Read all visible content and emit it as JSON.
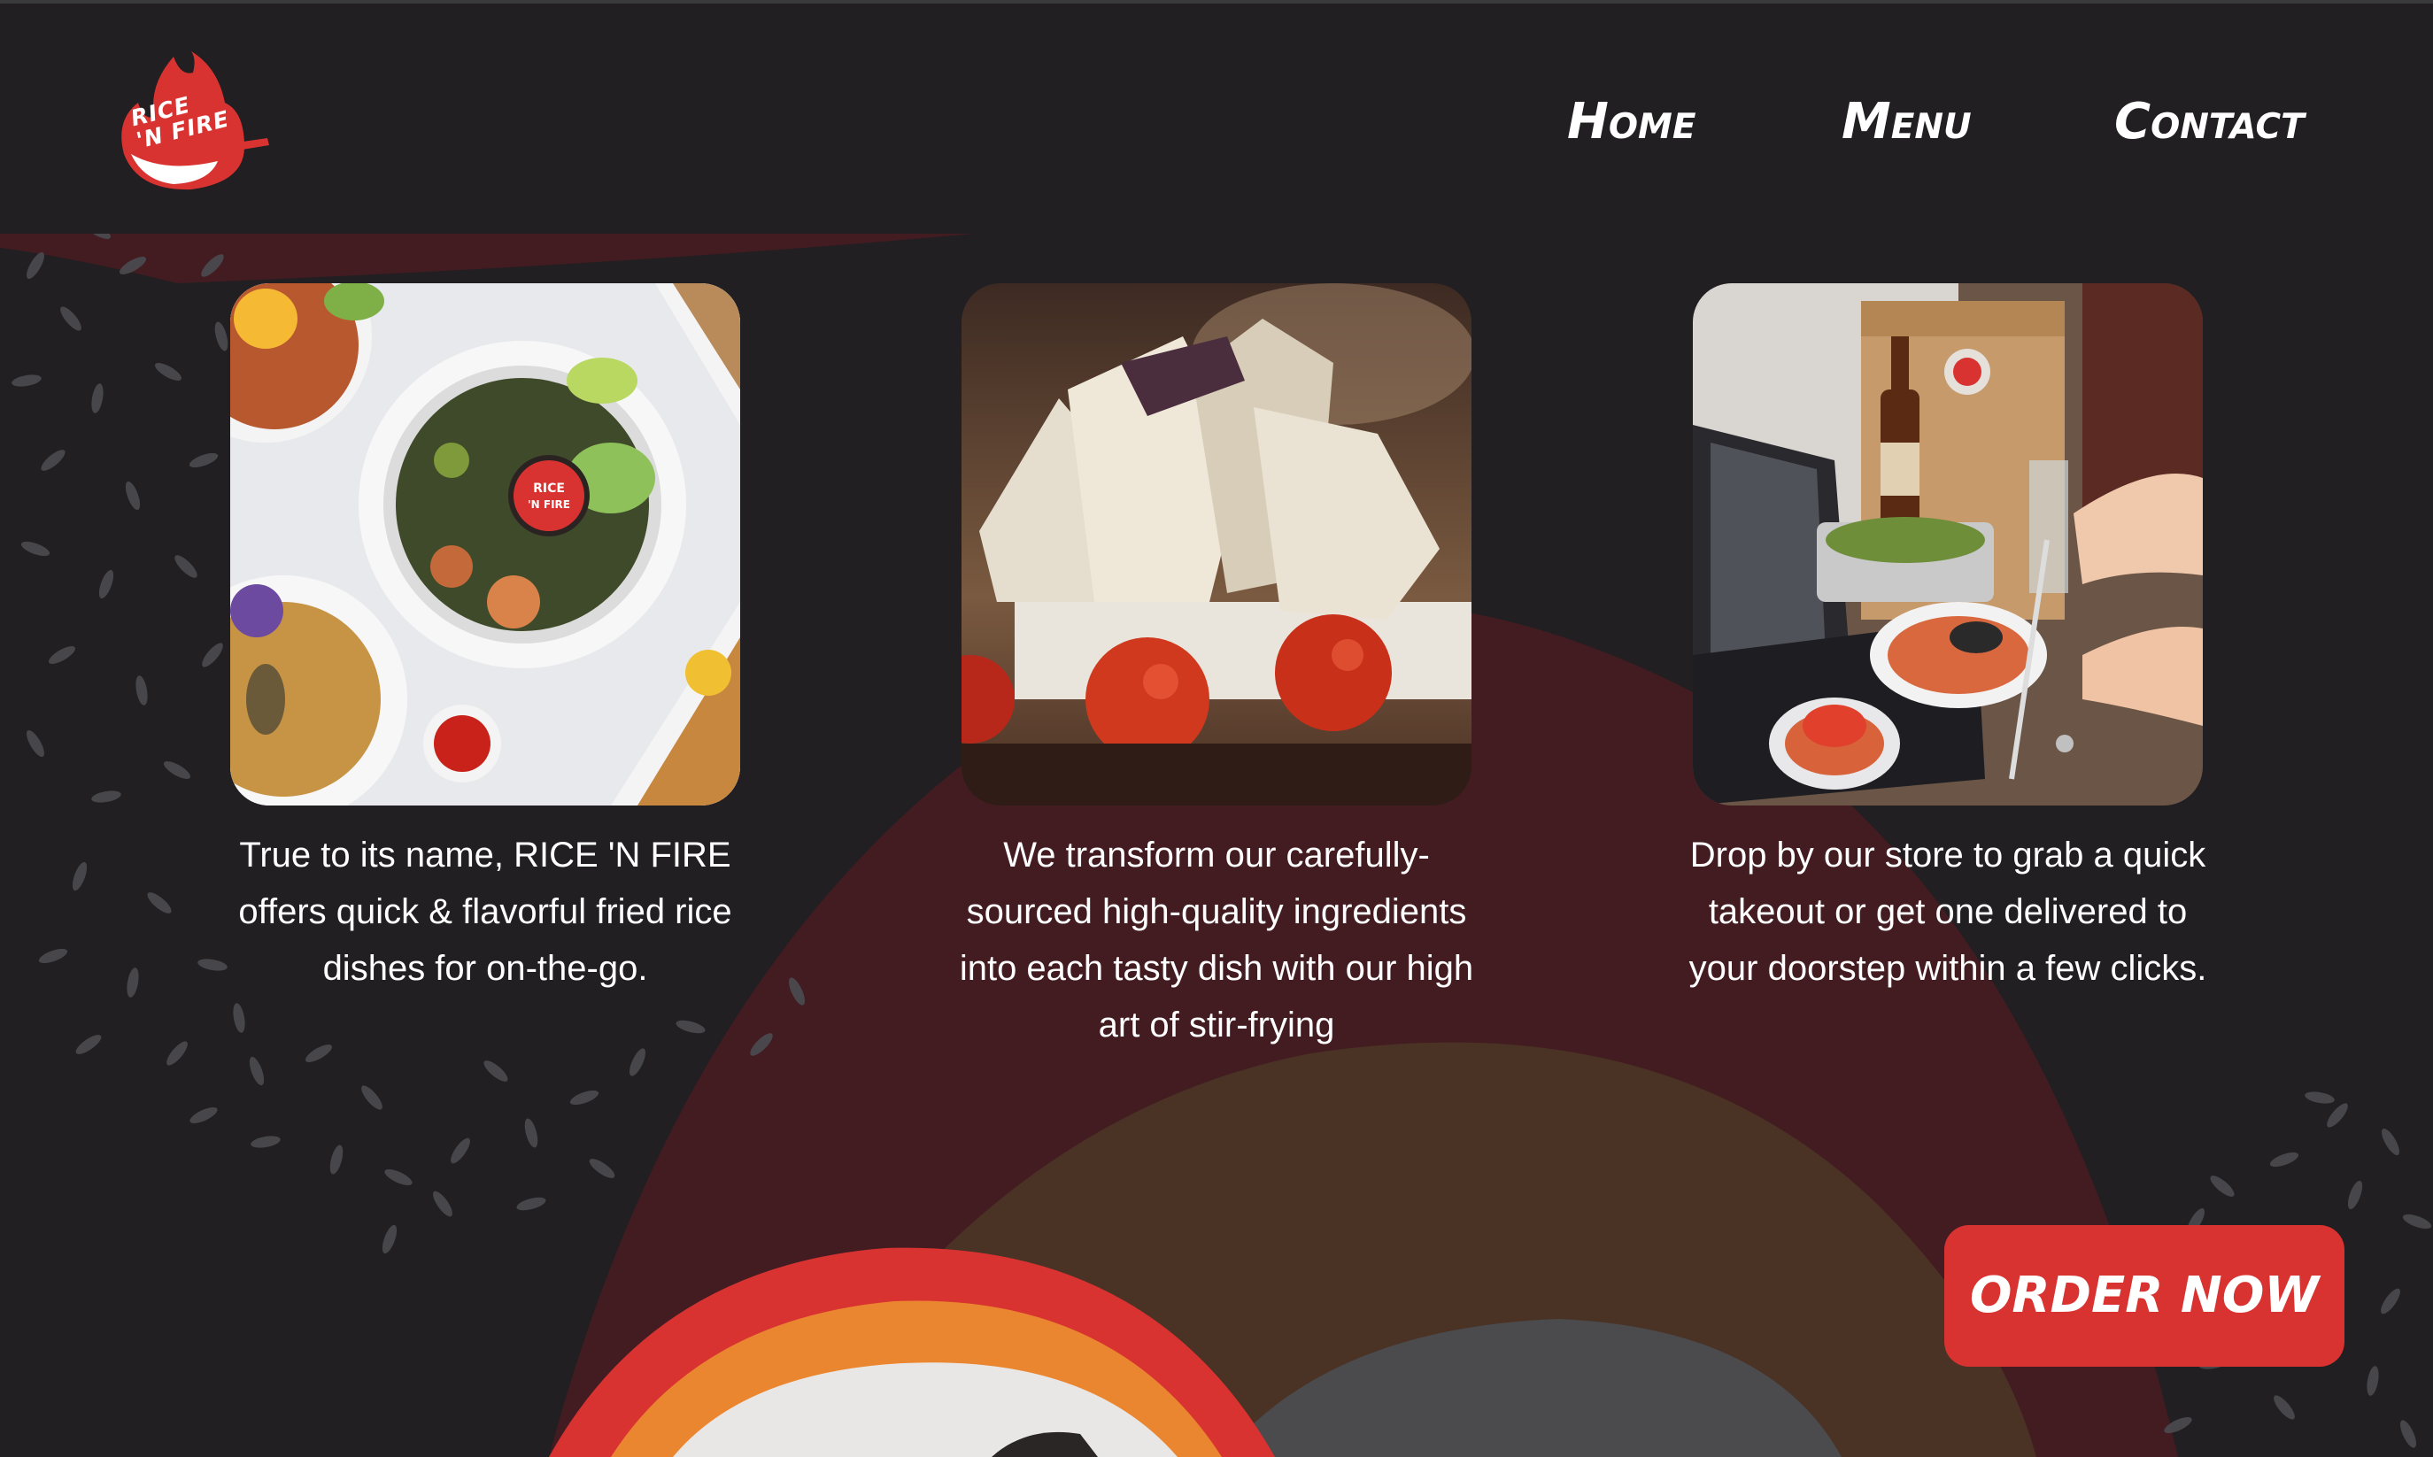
{
  "brand": {
    "logo_line1": "RICE",
    "logo_line2": "'N FIRE",
    "logo_name": "flame-logo-icon"
  },
  "nav": {
    "home": "Home",
    "menu": "Menu",
    "contact": "Contact"
  },
  "cards": [
    {
      "image_name": "fried-rice-bowls-photo",
      "text": "True to its name, RICE 'N FIRE offers quick & flavorful fried rice dishes for on-the-go."
    },
    {
      "image_name": "ingredients-photo",
      "text": "We transform our carefully-sourced high-quality ingredients into each tasty dish with our high art of stir-frying"
    },
    {
      "image_name": "takeout-order-photo",
      "text": "Drop by our store to grab a quick takeout or get one delivered to your doorstep within a few clicks."
    }
  ],
  "cta": {
    "order_label": "ORDER NOW"
  },
  "colors": {
    "background": "#211f21",
    "accent_red": "#d93331",
    "dark_red": "#431c22",
    "brown": "#4a3225",
    "orange": "#ea8630",
    "text": "#ffffff"
  }
}
